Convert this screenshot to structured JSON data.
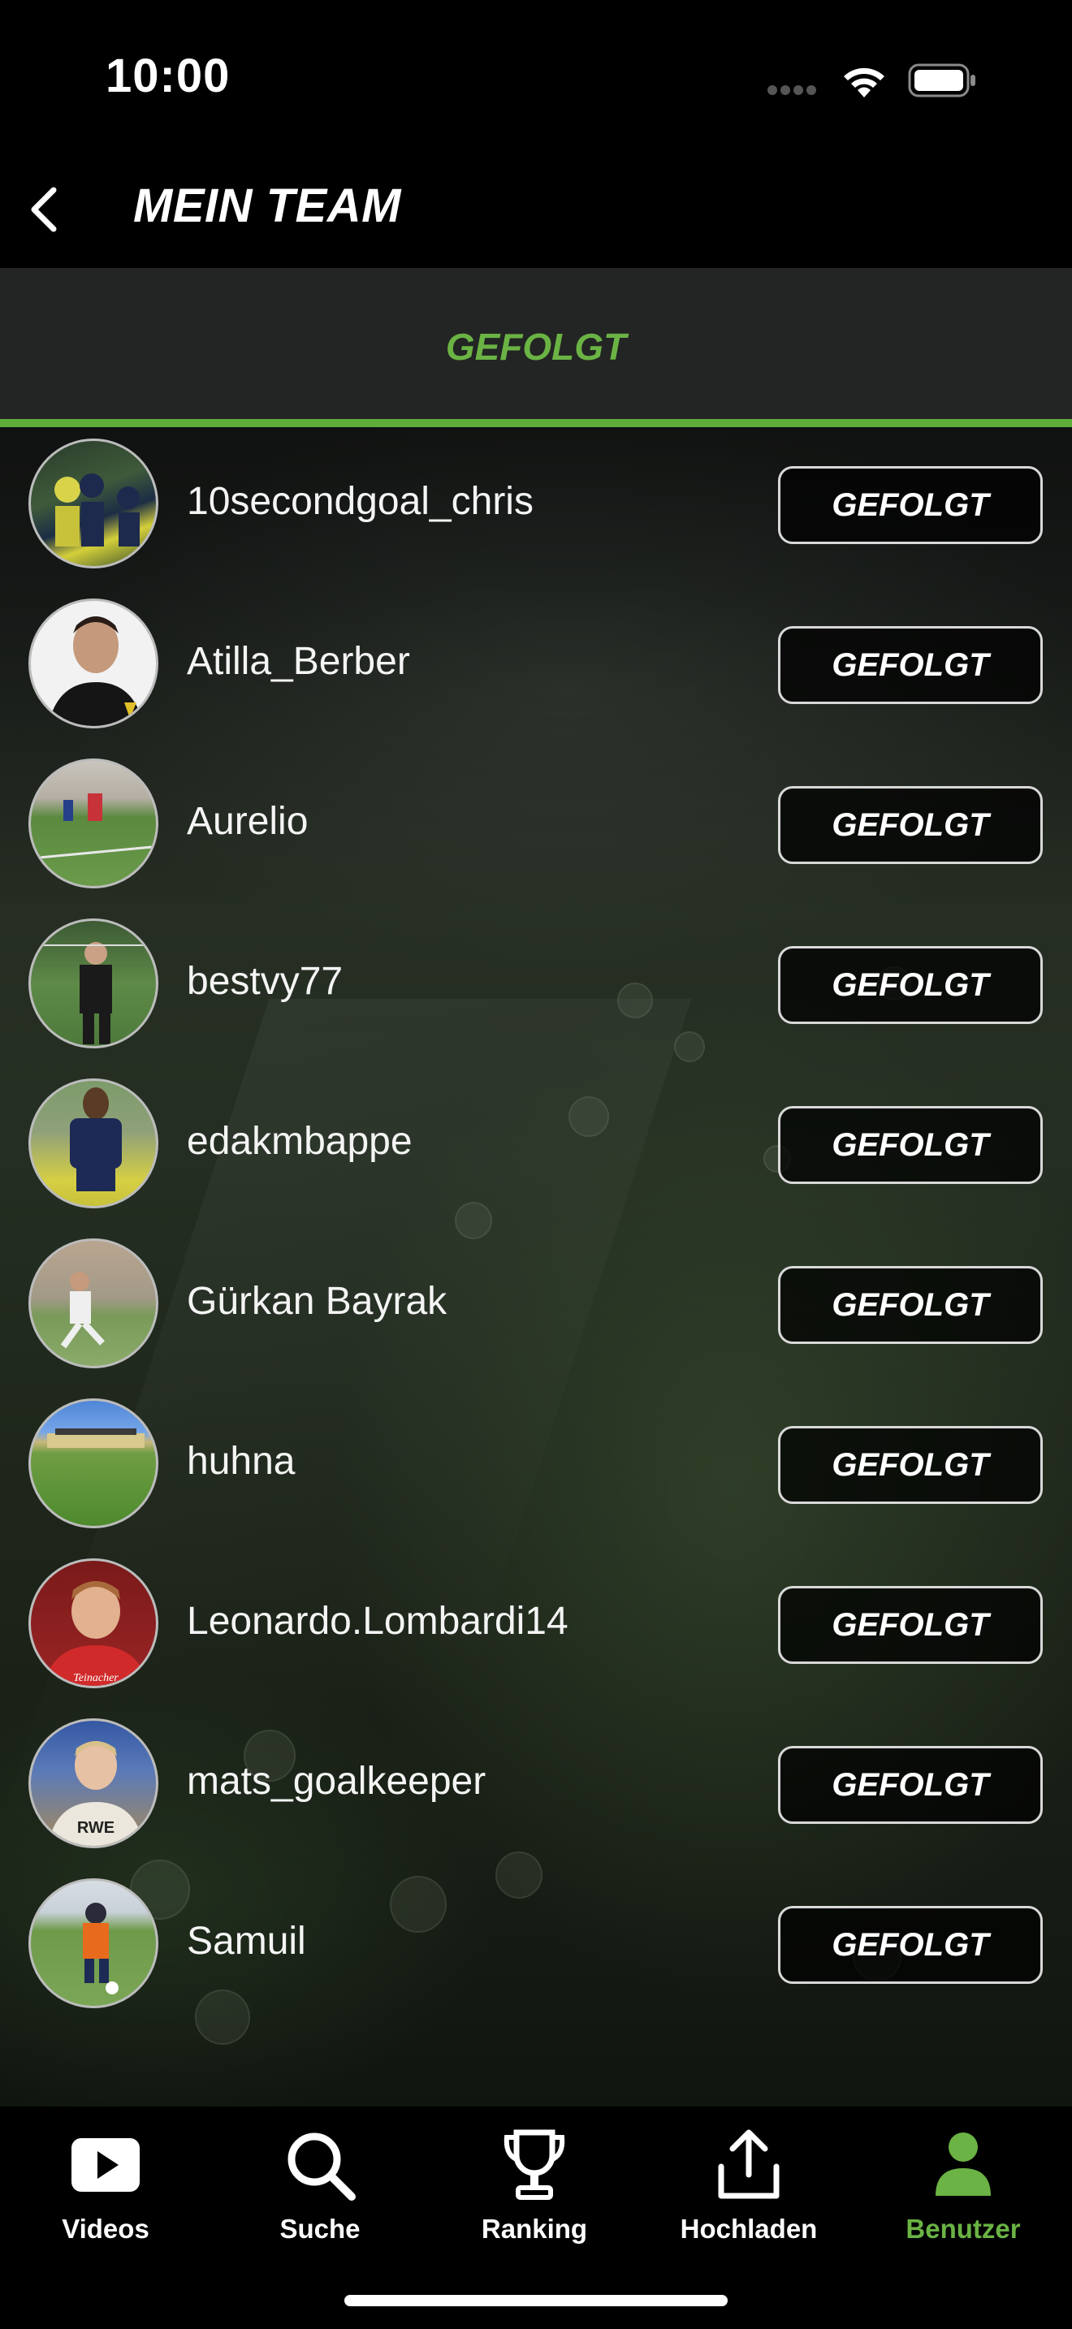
{
  "status_bar": {
    "time": "10:00"
  },
  "header": {
    "title": "MEIN TEAM"
  },
  "tabs": [
    {
      "label": "GEFOLGT",
      "active": true
    }
  ],
  "accent_color": "#6ab344",
  "users": [
    {
      "name": "10secondgoal_chris",
      "button": "GEFOLGT"
    },
    {
      "name": "Atilla_Berber",
      "button": "GEFOLGT"
    },
    {
      "name": "Aurelio",
      "button": "GEFOLGT"
    },
    {
      "name": "bestvy77",
      "button": "GEFOLGT"
    },
    {
      "name": "edakmbappe",
      "button": "GEFOLGT"
    },
    {
      "name": "Gürkan Bayrak",
      "button": "GEFOLGT"
    },
    {
      "name": "huhna",
      "button": "GEFOLGT"
    },
    {
      "name": "Leonardo.Lombardi14",
      "button": "GEFOLGT"
    },
    {
      "name": "mats_goalkeeper",
      "button": "GEFOLGT"
    },
    {
      "name": "Samuil",
      "button": "GEFOLGT"
    }
  ],
  "bottom_nav": [
    {
      "label": "Videos",
      "icon": "play-icon",
      "active": false
    },
    {
      "label": "Suche",
      "icon": "search-icon",
      "active": false
    },
    {
      "label": "Ranking",
      "icon": "trophy-icon",
      "active": false
    },
    {
      "label": "Hochladen",
      "icon": "upload-icon",
      "active": false
    },
    {
      "label": "Benutzer",
      "icon": "user-icon",
      "active": true
    }
  ]
}
